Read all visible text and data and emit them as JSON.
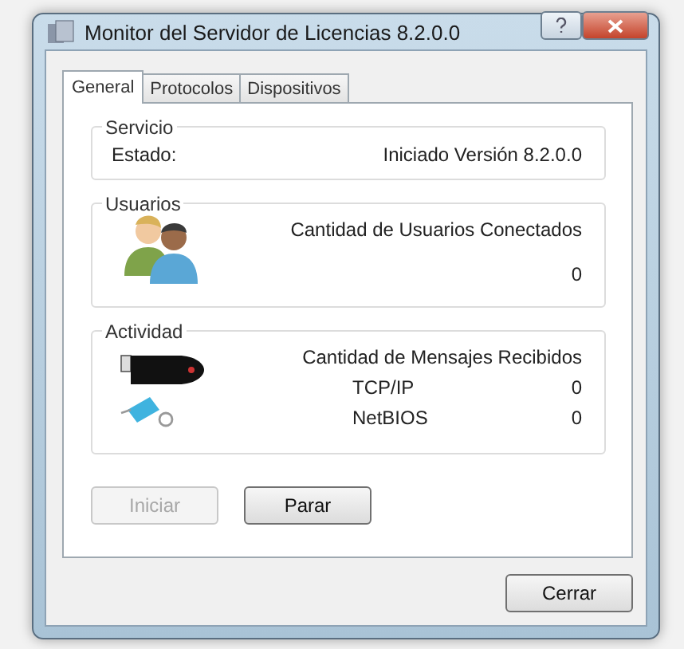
{
  "window": {
    "title": "Monitor del Servidor de Licencias 8.2.0.0"
  },
  "tabs": [
    {
      "label": "General",
      "selected": true
    },
    {
      "label": "Protocolos",
      "selected": false
    },
    {
      "label": "Dispositivos",
      "selected": false
    }
  ],
  "servicio": {
    "title": "Servicio",
    "label": "Estado:",
    "value": "Iniciado Versión 8.2.0.0"
  },
  "usuarios": {
    "title": "Usuarios",
    "label": "Cantidad de Usuarios Conectados",
    "value": "0"
  },
  "actividad": {
    "title": "Actividad",
    "label": "Cantidad de Mensajes Recibidos",
    "rows": [
      {
        "name": "TCP/IP",
        "value": "0"
      },
      {
        "name": "NetBIOS",
        "value": "0"
      }
    ]
  },
  "buttons": [
    {
      "label": "Iniciar",
      "disabled": true
    },
    {
      "label": "Parar",
      "disabled": false
    }
  ],
  "close_button": "Cerrar"
}
